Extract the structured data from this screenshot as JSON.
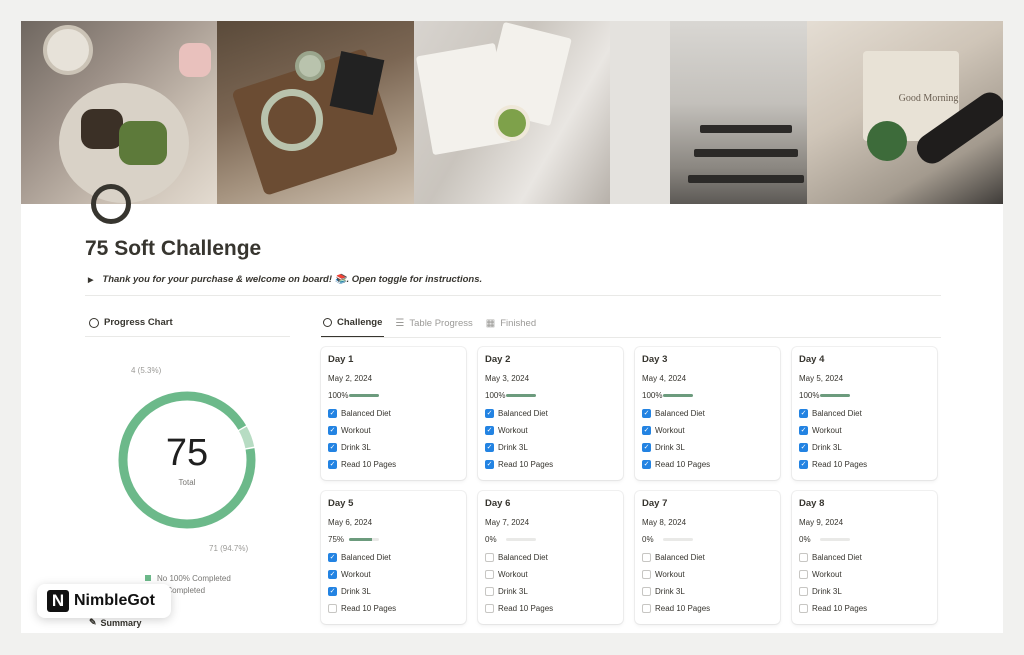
{
  "page": {
    "title": "75 Soft Challenge",
    "toggle_text": "Thank you for your purchase & welcome on board! 📚. Open toggle for instructions."
  },
  "cover": {
    "bag_text": "Good Morning"
  },
  "progress_chart": {
    "heading": "Progress Chart",
    "total": "75",
    "total_label": "Total",
    "slices": [
      {
        "label": "71 (94.7%)",
        "value": 71,
        "color": "#6cb98a"
      },
      {
        "label": "4 (5.3%)",
        "value": 4,
        "color": "#b7dcc3"
      }
    ],
    "legend": [
      {
        "label": "No 100% Completed",
        "color": "#6cb98a"
      },
      {
        "label": "% Completed",
        "color": "#b7dcc3"
      }
    ]
  },
  "brand": {
    "logo": "N",
    "name": "NimbleGot"
  },
  "summary": {
    "label": "Summary"
  },
  "tabs": [
    {
      "label": "Challenge",
      "active": true,
      "icon": "circle-icon"
    },
    {
      "label": "Table Progress",
      "active": false,
      "icon": "list-icon"
    },
    {
      "label": "Finished",
      "active": false,
      "icon": "board-icon"
    }
  ],
  "cards": [
    {
      "day": "Day 1",
      "date": "May 2, 2024",
      "pct_label": "100%",
      "pct": 100,
      "tasks": [
        {
          "label": "Balanced Diet",
          "done": true
        },
        {
          "label": "Workout",
          "done": true
        },
        {
          "label": "Drink 3L",
          "done": true
        },
        {
          "label": "Read 10 Pages",
          "done": true
        }
      ]
    },
    {
      "day": "Day 2",
      "date": "May 3, 2024",
      "pct_label": "100%",
      "pct": 100,
      "tasks": [
        {
          "label": "Balanced Diet",
          "done": true
        },
        {
          "label": "Workout",
          "done": true
        },
        {
          "label": "Drink 3L",
          "done": true
        },
        {
          "label": "Read 10 Pages",
          "done": true
        }
      ]
    },
    {
      "day": "Day 3",
      "date": "May 4, 2024",
      "pct_label": "100%",
      "pct": 100,
      "tasks": [
        {
          "label": "Balanced Diet",
          "done": true
        },
        {
          "label": "Workout",
          "done": true
        },
        {
          "label": "Drink 3L",
          "done": true
        },
        {
          "label": "Read 10 Pages",
          "done": true
        }
      ]
    },
    {
      "day": "Day 4",
      "date": "May 5, 2024",
      "pct_label": "100%",
      "pct": 100,
      "tasks": [
        {
          "label": "Balanced Diet",
          "done": true
        },
        {
          "label": "Workout",
          "done": true
        },
        {
          "label": "Drink 3L",
          "done": true
        },
        {
          "label": "Read 10 Pages",
          "done": true
        }
      ]
    },
    {
      "day": "Day 5",
      "date": "May 6, 2024",
      "pct_label": "75%",
      "pct": 75,
      "tasks": [
        {
          "label": "Balanced Diet",
          "done": true
        },
        {
          "label": "Workout",
          "done": true
        },
        {
          "label": "Drink 3L",
          "done": true
        },
        {
          "label": "Read 10 Pages",
          "done": false
        }
      ]
    },
    {
      "day": "Day 6",
      "date": "May 7, 2024",
      "pct_label": "0%",
      "pct": 0,
      "tasks": [
        {
          "label": "Balanced Diet",
          "done": false
        },
        {
          "label": "Workout",
          "done": false
        },
        {
          "label": "Drink 3L",
          "done": false
        },
        {
          "label": "Read 10 Pages",
          "done": false
        }
      ]
    },
    {
      "day": "Day 7",
      "date": "May 8, 2024",
      "pct_label": "0%",
      "pct": 0,
      "tasks": [
        {
          "label": "Balanced Diet",
          "done": false
        },
        {
          "label": "Workout",
          "done": false
        },
        {
          "label": "Drink 3L",
          "done": false
        },
        {
          "label": "Read 10 Pages",
          "done": false
        }
      ]
    },
    {
      "day": "Day 8",
      "date": "May 9, 2024",
      "pct_label": "0%",
      "pct": 0,
      "tasks": [
        {
          "label": "Balanced Diet",
          "done": false
        },
        {
          "label": "Workout",
          "done": false
        },
        {
          "label": "Drink 3L",
          "done": false
        },
        {
          "label": "Read 10 Pages",
          "done": false
        }
      ]
    }
  ],
  "colors": {
    "accent_green": "#6c9b7d",
    "checkbox_blue": "#2383e2"
  }
}
